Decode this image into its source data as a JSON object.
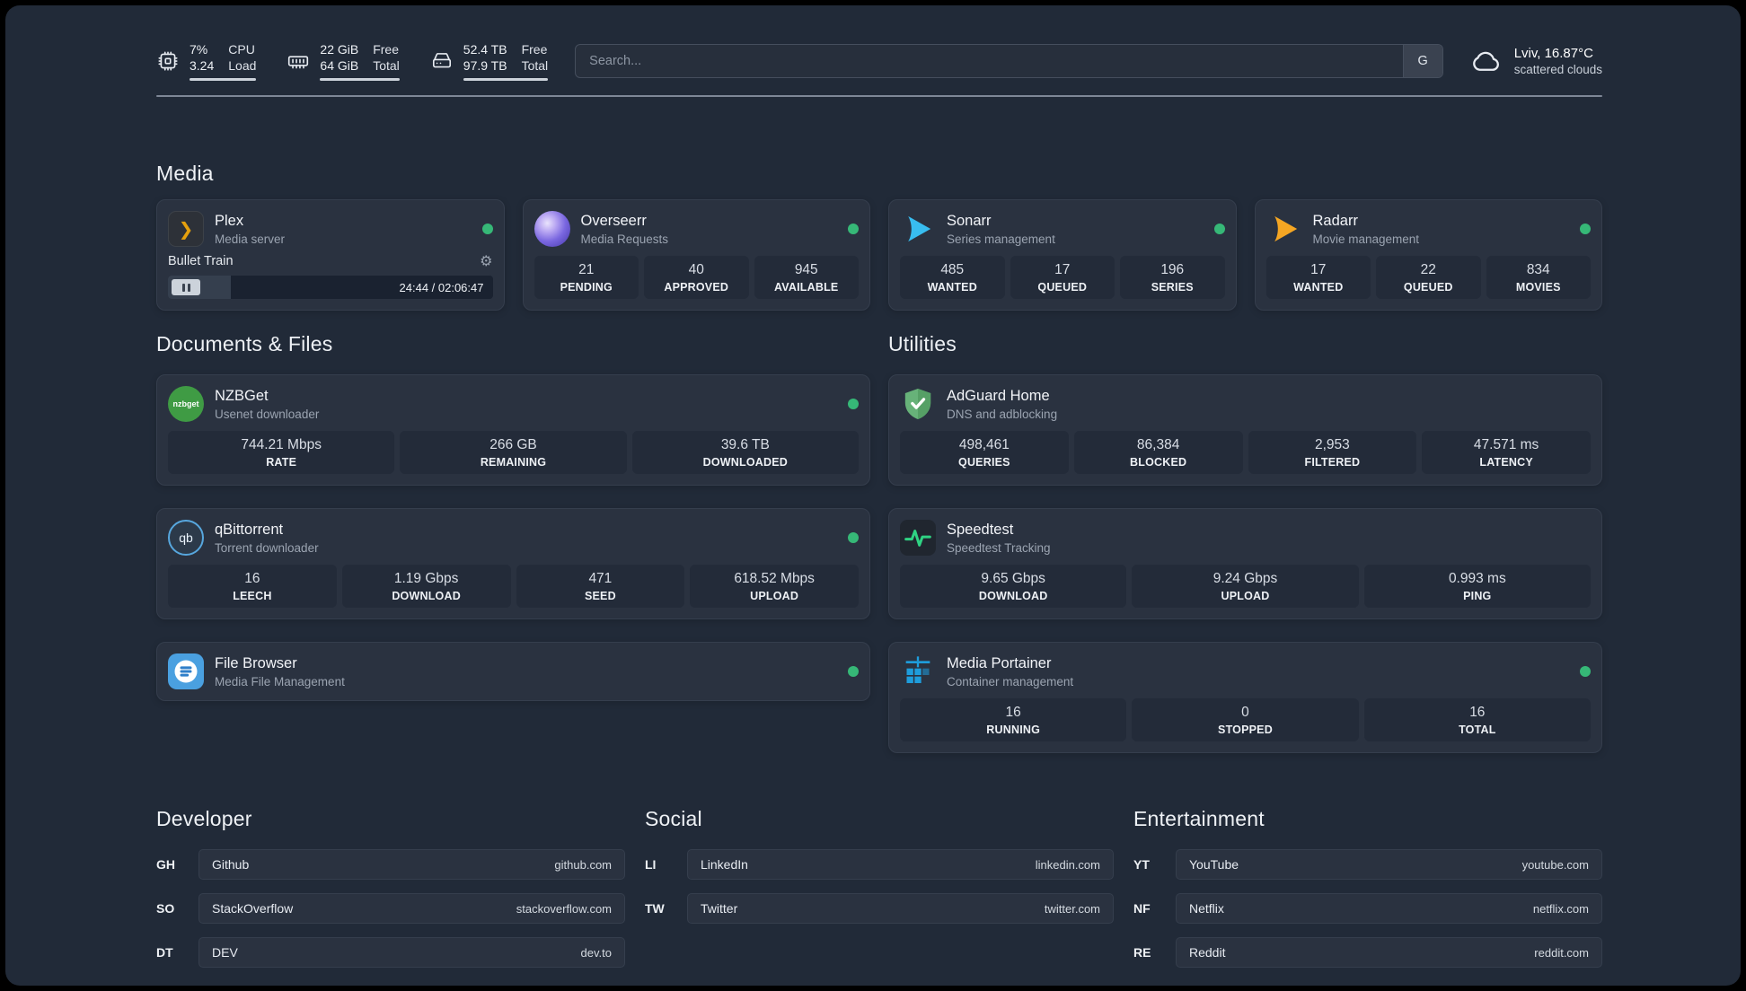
{
  "theme": {
    "background": "#212a38",
    "card": "#2a3240",
    "stat_box": "#232b39",
    "accent_green": "#36b877"
  },
  "topbar": {
    "cpu": {
      "value_line1": "7%",
      "value_line2": "3.24",
      "label_line1": "CPU",
      "label_line2": "Load"
    },
    "memory": {
      "value_line1": "22 GiB",
      "value_line2": "64 GiB",
      "label_line1": "Free",
      "label_line2": "Total"
    },
    "disk": {
      "value_line1": "52.4 TB",
      "value_line2": "97.9 TB",
      "label_line1": "Free",
      "label_line2": "Total"
    },
    "search": {
      "placeholder": "Search...",
      "engine_button": "G"
    },
    "weather": {
      "location": "Lviv, 16.87°C",
      "condition": "scattered clouds"
    }
  },
  "media": {
    "title": "Media",
    "plex": {
      "name": "Plex",
      "subtitle": "Media server",
      "now_playing": "Bullet Train",
      "gear_icon": "⚙",
      "time": "24:44 / 02:06:47",
      "progress_percent": 19.5,
      "progress_style": "width:19.5%"
    },
    "overseerr": {
      "name": "Overseerr",
      "subtitle": "Media Requests",
      "stats": [
        {
          "value": "21",
          "label": "PENDING"
        },
        {
          "value": "40",
          "label": "APPROVED"
        },
        {
          "value": "945",
          "label": "AVAILABLE"
        }
      ]
    },
    "sonarr": {
      "name": "Sonarr",
      "subtitle": "Series management",
      "stats": [
        {
          "value": "485",
          "label": "WANTED"
        },
        {
          "value": "17",
          "label": "QUEUED"
        },
        {
          "value": "196",
          "label": "SERIES"
        }
      ]
    },
    "radarr": {
      "name": "Radarr",
      "subtitle": "Movie management",
      "stats": [
        {
          "value": "17",
          "label": "WANTED"
        },
        {
          "value": "22",
          "label": "QUEUED"
        },
        {
          "value": "834",
          "label": "MOVIES"
        }
      ]
    }
  },
  "documents": {
    "title": "Documents & Files",
    "nzbget": {
      "name": "NZBGet",
      "subtitle": "Usenet downloader",
      "icon_text": "nzbget",
      "stats": [
        {
          "value": "744.21 Mbps",
          "label": "RATE"
        },
        {
          "value": "266 GB",
          "label": "REMAINING"
        },
        {
          "value": "39.6 TB",
          "label": "DOWNLOADED"
        }
      ]
    },
    "qbittorrent": {
      "name": "qBittorrent",
      "subtitle": "Torrent downloader",
      "icon_text": "qb",
      "stats": [
        {
          "value": "16",
          "label": "LEECH"
        },
        {
          "value": "1.19 Gbps",
          "label": "DOWNLOAD"
        },
        {
          "value": "471",
          "label": "SEED"
        },
        {
          "value": "618.52 Mbps",
          "label": "UPLOAD"
        }
      ]
    },
    "filebrowser": {
      "name": "File Browser",
      "subtitle": "Media File Management"
    }
  },
  "utilities": {
    "title": "Utilities",
    "adguard": {
      "name": "AdGuard Home",
      "subtitle": "DNS and adblocking",
      "stats": [
        {
          "value": "498,461",
          "label": "QUERIES"
        },
        {
          "value": "86,384",
          "label": "BLOCKED"
        },
        {
          "value": "2,953",
          "label": "FILTERED"
        },
        {
          "value": "47.571 ms",
          "label": "LATENCY"
        }
      ]
    },
    "speedtest": {
      "name": "Speedtest",
      "subtitle": "Speedtest Tracking",
      "stats": [
        {
          "value": "9.65 Gbps",
          "label": "DOWNLOAD"
        },
        {
          "value": "9.24 Gbps",
          "label": "UPLOAD"
        },
        {
          "value": "0.993 ms",
          "label": "PING"
        }
      ]
    },
    "portainer": {
      "name": "Media Portainer",
      "subtitle": "Container management",
      "stats": [
        {
          "value": "16",
          "label": "RUNNING"
        },
        {
          "value": "0",
          "label": "STOPPED"
        },
        {
          "value": "16",
          "label": "TOTAL"
        }
      ]
    }
  },
  "bookmarks": {
    "developer": {
      "title": "Developer",
      "items": [
        {
          "abbr": "GH",
          "name": "Github",
          "url": "github.com"
        },
        {
          "abbr": "SO",
          "name": "StackOverflow",
          "url": "stackoverflow.com"
        },
        {
          "abbr": "DT",
          "name": "DEV",
          "url": "dev.to"
        }
      ]
    },
    "social": {
      "title": "Social",
      "items": [
        {
          "abbr": "LI",
          "name": "LinkedIn",
          "url": "linkedin.com"
        },
        {
          "abbr": "TW",
          "name": "Twitter",
          "url": "twitter.com"
        }
      ]
    },
    "entertainment": {
      "title": "Entertainment",
      "items": [
        {
          "abbr": "YT",
          "name": "YouTube",
          "url": "youtube.com"
        },
        {
          "abbr": "NF",
          "name": "Netflix",
          "url": "netflix.com"
        },
        {
          "abbr": "RE",
          "name": "Reddit",
          "url": "reddit.com"
        }
      ]
    }
  }
}
